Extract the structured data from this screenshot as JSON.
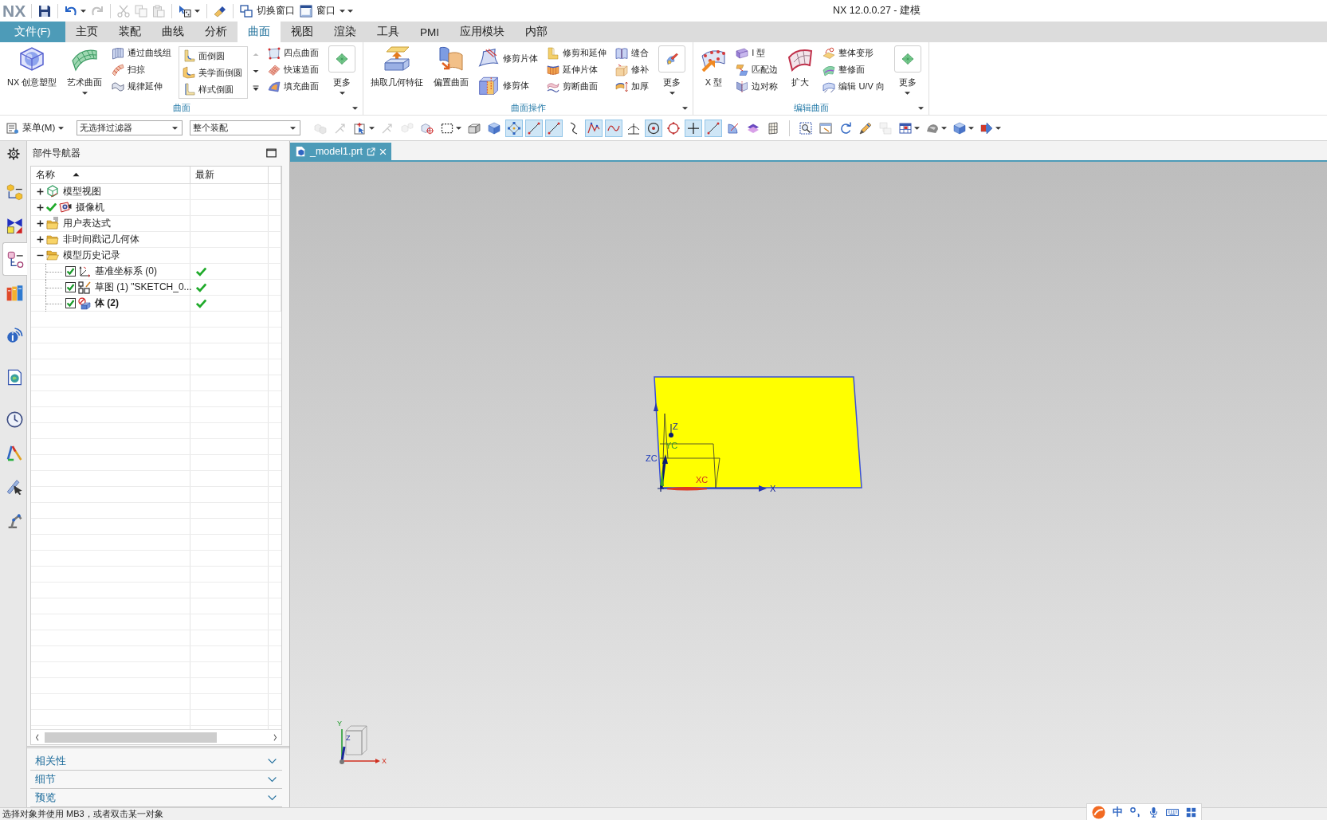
{
  "title_bar": {
    "logo": "NX",
    "quick_access": [
      {
        "disabled": false,
        "dropdown": false
      },
      {
        "disabled": false,
        "dropdown": true
      },
      {
        "disabled": true,
        "dropdown": false
      },
      {
        "disabled": true,
        "dropdown": false
      },
      {
        "disabled": true,
        "dropdown": false
      },
      {
        "disabled": true,
        "dropdown": false
      },
      {
        "disabled": false,
        "dropdown": true
      },
      {
        "disabled": false,
        "dropdown": false
      }
    ],
    "switch_window": "切换窗口",
    "window_menu": "窗口",
    "title": "NX 12.0.0.27 - 建模"
  },
  "tabs": [
    {
      "label": "文件(F)",
      "kind": "file",
      "selected": false
    },
    {
      "label": "主页",
      "kind": "tab",
      "selected": false
    },
    {
      "label": "装配",
      "kind": "tab",
      "selected": false
    },
    {
      "label": "曲线",
      "kind": "tab",
      "selected": false
    },
    {
      "label": "分析",
      "kind": "tab",
      "selected": false
    },
    {
      "label": "曲面",
      "kind": "tab",
      "selected": true
    },
    {
      "label": "视图",
      "kind": "tab",
      "selected": false
    },
    {
      "label": "渲染",
      "kind": "tab",
      "selected": false
    },
    {
      "label": "工具",
      "kind": "tab",
      "selected": false
    },
    {
      "label": "PMI",
      "kind": "tab",
      "selected": false
    },
    {
      "label": "应用模块",
      "kind": "tab",
      "selected": false
    },
    {
      "label": "内部",
      "kind": "tab",
      "selected": false
    }
  ],
  "ribbon_groups": [
    {
      "label": "曲面",
      "items": [
        {
          "kind": "large",
          "label": "NX 创意塑型",
          "dropdown": false
        },
        {
          "kind": "large",
          "label": "艺术曲面",
          "dropdown": true
        },
        {
          "kind": "stack",
          "buttons": [
            {
              "label": "通过曲线组"
            },
            {
              "label": "扫掠"
            },
            {
              "label": "规律延伸"
            }
          ]
        },
        {
          "kind": "gallery",
          "buttons": [
            {
              "label": "面倒圆"
            },
            {
              "label": "美学面倒圆"
            },
            {
              "label": "样式倒圆"
            }
          ]
        },
        {
          "kind": "stack",
          "buttons": [
            {
              "label": "四点曲面"
            },
            {
              "label": "快速造面"
            },
            {
              "label": "填充曲面"
            }
          ]
        },
        {
          "kind": "more",
          "label": "更多",
          "dropdown": true
        }
      ]
    },
    {
      "label": "曲面操作",
      "items": [
        {
          "kind": "large",
          "label": "抽取几何特征",
          "dropdown": false
        },
        {
          "kind": "large",
          "label": "偏置曲面",
          "dropdown": false
        },
        {
          "kind": "pair",
          "buttons": [
            {
              "label": "修剪片体"
            },
            {
              "label": "修剪体"
            }
          ]
        },
        {
          "kind": "stack",
          "buttons": [
            {
              "label": "修剪和延伸"
            },
            {
              "label": "延伸片体"
            },
            {
              "label": "剪断曲面"
            }
          ]
        },
        {
          "kind": "stack",
          "buttons": [
            {
              "label": "缝合"
            },
            {
              "label": "修补"
            },
            {
              "label": "加厚"
            }
          ]
        },
        {
          "kind": "more",
          "label": "更多",
          "dropdown": true
        }
      ]
    },
    {
      "label": "编辑曲面",
      "items": [
        {
          "kind": "large",
          "label": "X 型",
          "dropdown": false
        },
        {
          "kind": "stack",
          "buttons": [
            {
              "label": "I 型"
            },
            {
              "label": "匹配边"
            },
            {
              "label": "边对称"
            }
          ]
        },
        {
          "kind": "large",
          "label": "扩大",
          "dropdown": false
        },
        {
          "kind": "stack",
          "buttons": [
            {
              "label": "整体变形"
            },
            {
              "label": "整修面"
            },
            {
              "label": "编辑 U/V 向"
            }
          ]
        },
        {
          "kind": "more",
          "label": "更多",
          "dropdown": true
        }
      ]
    }
  ],
  "toolbar": {
    "menu": "菜单(M)",
    "selection_filter": "无选择过滤器",
    "scope": "整个装配",
    "tool_groups": [
      {
        "tools": [
          {
            "on": false,
            "disabled": true,
            "dropdown": false
          },
          {
            "on": false,
            "disabled": true,
            "dropdown": false
          },
          {
            "on": false,
            "disabled": false,
            "dropdown": true
          },
          {
            "on": false,
            "disabled": true,
            "dropdown": false
          },
          {
            "on": false,
            "disabled": true,
            "dropdown": false
          },
          {
            "on": false,
            "disabled": false,
            "dropdown": false
          },
          {
            "on": false,
            "disabled": false,
            "dropdown": true
          },
          {
            "on": false,
            "disabled": false,
            "dropdown": false
          },
          {
            "on": false,
            "disabled": false,
            "dropdown": false
          },
          {
            "on": true,
            "disabled": false,
            "dropdown": false
          },
          {
            "on": true,
            "disabled": false,
            "dropdown": false
          },
          {
            "on": true,
            "disabled": false,
            "dropdown": false
          },
          {
            "on": false,
            "disabled": false,
            "dropdown": false
          },
          {
            "on": true,
            "disabled": false,
            "dropdown": false
          },
          {
            "on": true,
            "disabled": false,
            "dropdown": false
          },
          {
            "on": false,
            "disabled": false,
            "dropdown": false
          },
          {
            "on": true,
            "disabled": false,
            "dropdown": false
          },
          {
            "on": false,
            "disabled": false,
            "dropdown": false
          },
          {
            "on": true,
            "disabled": false,
            "dropdown": false
          },
          {
            "on": true,
            "disabled": false,
            "dropdown": false
          },
          {
            "on": false,
            "disabled": false,
            "dropdown": false
          },
          {
            "on": false,
            "disabled": false,
            "dropdown": false
          },
          {
            "on": false,
            "disabled": false,
            "dropdown": false
          }
        ]
      },
      {
        "tools": [
          {
            "on": false,
            "disabled": false,
            "dropdown": false
          },
          {
            "on": false,
            "disabled": false,
            "dropdown": false
          },
          {
            "on": false,
            "disabled": false,
            "dropdown": false
          },
          {
            "on": false,
            "disabled": false,
            "dropdown": false
          },
          {
            "on": false,
            "disabled": true,
            "dropdown": false
          },
          {
            "on": false,
            "disabled": false,
            "dropdown": true
          },
          {
            "on": false,
            "disabled": false,
            "dropdown": true
          },
          {
            "on": false,
            "disabled": false,
            "dropdown": true
          },
          {
            "on": false,
            "disabled": false,
            "dropdown": true
          }
        ]
      }
    ]
  },
  "resource_bar": [
    {
      "selected": false
    },
    {
      "selected": false
    },
    {
      "selected": true
    },
    {
      "selected": false
    },
    {
      "selected": false
    },
    {
      "selected": false
    },
    {
      "selected": false
    },
    {
      "selected": false
    },
    {
      "selected": false
    },
    {
      "selected": false
    }
  ],
  "part_navigator": {
    "title": "部件导航器",
    "columns": [
      "名称",
      "最新"
    ],
    "nodes": [
      {
        "label": "模型视图",
        "expanded": false,
        "active": false
      },
      {
        "label": "摄像机",
        "expanded": false,
        "active": true
      },
      {
        "label": "用户表达式",
        "expanded": false,
        "active": false
      },
      {
        "label": "非时间戳记几何体",
        "expanded": false,
        "active": false
      },
      {
        "label": "模型历史记录",
        "expanded": true,
        "active": false,
        "children": [
          {
            "label": "基准坐标系 (0)",
            "checked": true,
            "up_to_date": true,
            "current": false
          },
          {
            "label": "草图 (1) \"SKETCH_0...",
            "checked": true,
            "up_to_date": true,
            "current": false
          },
          {
            "label": "体 (2)",
            "checked": true,
            "up_to_date": true,
            "current": true
          }
        ]
      }
    ]
  },
  "panels": [
    {
      "label": "相关性",
      "expanded": false
    },
    {
      "label": "细节",
      "expanded": false
    },
    {
      "label": "预览",
      "expanded": false
    }
  ],
  "graphics": {
    "tab": "_model1.prt",
    "axis_labels": [
      "Z",
      "YC",
      "ZC",
      "XC",
      "X"
    ],
    "view_axis_labels": [
      "Y",
      "Z",
      "X"
    ]
  },
  "status_bar": {
    "message": "选择对象并使用 MB3，或者双击某一对象",
    "input_mode": "中"
  }
}
